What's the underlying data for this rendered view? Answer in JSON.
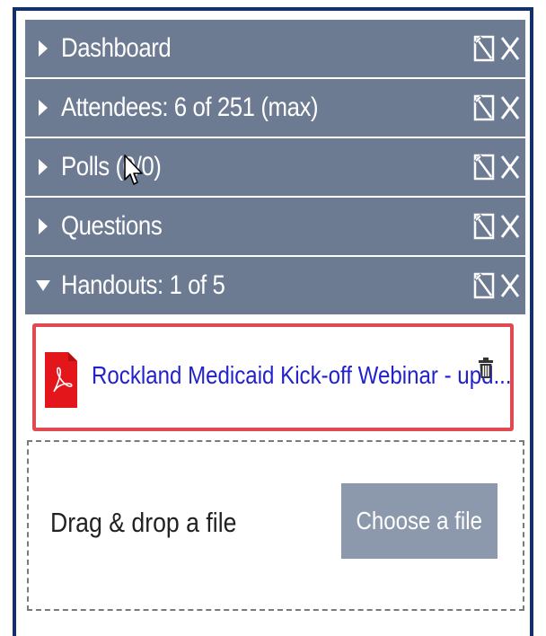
{
  "sections": [
    {
      "id": "dashboard",
      "label": "Dashboard",
      "expanded": false
    },
    {
      "id": "attendees",
      "label": "Attendees:  6 of 251 (max)",
      "expanded": false
    },
    {
      "id": "polls",
      "label": "Polls (0/0)",
      "expanded": false
    },
    {
      "id": "questions",
      "label": "Questions",
      "expanded": false
    },
    {
      "id": "handouts",
      "label": "Handouts: 1 of 5",
      "expanded": true
    }
  ],
  "handouts": {
    "files": [
      {
        "name": "Rockland Medicaid Kick-off Webinar - upd...",
        "type": "pdf"
      }
    ],
    "drop_text": "Drag & drop a file",
    "choose_label": "Choose a file"
  },
  "colors": {
    "header_bg": "#6c7a92",
    "highlight_border": "#e14a52",
    "link": "#2222cc",
    "button_bg": "#8c98ac",
    "frame": "#12306a"
  },
  "icons": {
    "collapsed": "triangle-right-icon",
    "expanded": "triangle-down-icon",
    "popout": "popout-icon",
    "close": "close-icon",
    "file": "pdf-icon",
    "delete": "trash-icon"
  }
}
